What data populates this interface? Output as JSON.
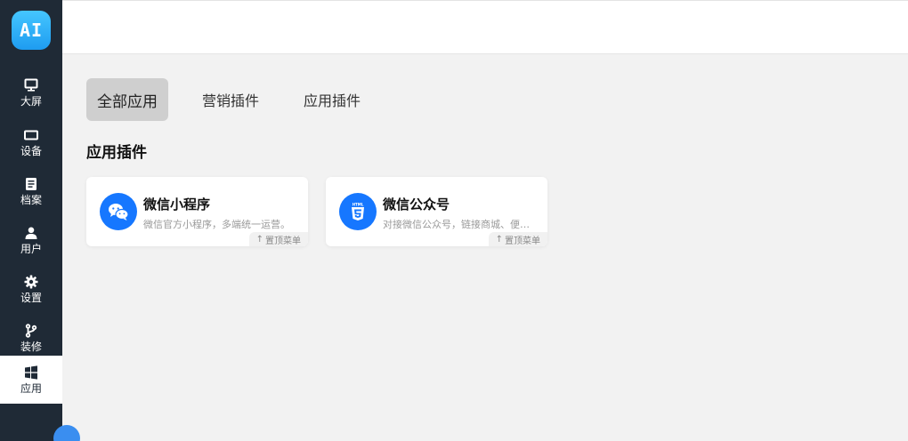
{
  "logo": {
    "text": "AI"
  },
  "sidebar": {
    "items": [
      {
        "label": "大屏",
        "icon": "monitor-icon"
      },
      {
        "label": "设备",
        "icon": "device-icon"
      },
      {
        "label": "档案",
        "icon": "archive-icon"
      },
      {
        "label": "用户",
        "icon": "user-icon"
      },
      {
        "label": "设置",
        "icon": "gear-icon"
      },
      {
        "label": "装修",
        "icon": "branch-icon"
      },
      {
        "label": "应用",
        "icon": "windows-icon",
        "active": true
      }
    ]
  },
  "tabs": [
    {
      "label": "全部应用",
      "active": true
    },
    {
      "label": "营销插件"
    },
    {
      "label": "应用插件"
    }
  ],
  "section": {
    "title": "应用插件"
  },
  "cards": [
    {
      "title": "微信小程序",
      "desc": "微信官方小程序，多端统一运营。",
      "pin": "置顶菜单",
      "icon": "wechat-icon"
    },
    {
      "title": "微信公众号",
      "desc": "对接微信公众号，链接商城、便于...",
      "pin": "置顶菜单",
      "icon": "html5-icon"
    }
  ],
  "colors": {
    "sidebar": "#1f2a36",
    "accent": "#1677ff",
    "background": "#f2f2f2"
  }
}
